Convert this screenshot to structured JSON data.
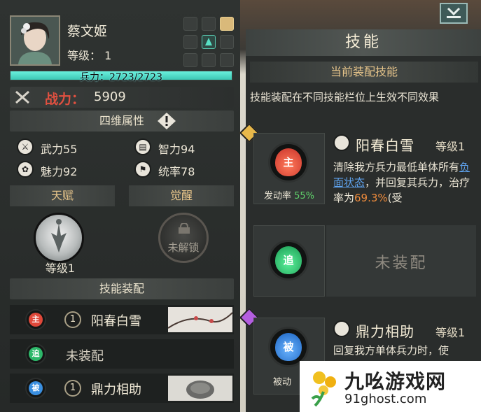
{
  "hero": {
    "name": "蔡文姬",
    "level_text": "等级：  1",
    "troops_text": "兵力：2723/2723",
    "troops_current": 2723,
    "troops_max": 2723,
    "power_label": "战力：",
    "power_value": "5909"
  },
  "attributes": {
    "header": "四维属性",
    "items": [
      {
        "label": "武力",
        "value": "55",
        "icon": "sword-icon"
      },
      {
        "label": "智力",
        "value": "94",
        "icon": "book-icon"
      },
      {
        "label": "魅力",
        "value": "92",
        "icon": "flower-icon"
      },
      {
        "label": "统率",
        "value": "78",
        "icon": "banner-icon"
      }
    ]
  },
  "talent": {
    "label": "天赋",
    "level_text": "等级1"
  },
  "awaken": {
    "label": "觉醒",
    "status": "未解锁"
  },
  "equip": {
    "header": "技能装配",
    "rows": [
      {
        "type_char": "主",
        "number": "1",
        "name": "阳春白雪",
        "color": "#e0483a"
      },
      {
        "type_char": "追",
        "number": "",
        "name": "未装配",
        "color": "#2db86a"
      },
      {
        "type_char": "被",
        "number": "1",
        "name": "鼎力相助",
        "color": "#3a8fe0"
      }
    ]
  },
  "skills_panel": {
    "title": "技能",
    "current_header": "当前装配技能",
    "current_desc": "技能装配在不同技能栏位上生效不同效果",
    "slot1": {
      "type_char": "主",
      "trigger_label": "发动率",
      "trigger_value": "55%",
      "name": "阳春白雪",
      "level": "等级1",
      "desc_a": "清除我方兵力最低单体所有",
      "desc_neg": "负面状态",
      "desc_b": "，并回复其兵力，治疗率为",
      "desc_pct": "69.3%",
      "desc_c": "(受"
    },
    "slot2": {
      "type_char": "追",
      "empty_text": "未装配"
    },
    "slot3": {
      "type_char": "被",
      "trigger_label": "被动",
      "name": "鼎力相助",
      "level": "等级1",
      "desc": "回复我方单体兵力时，使"
    }
  },
  "watermark": {
    "title": "九吆游戏网",
    "url": "91ghost.com"
  },
  "colors": {
    "accent_gold": "#e6c48a",
    "troop_bar": "#4fd9c4",
    "power_red": "#e05040"
  }
}
